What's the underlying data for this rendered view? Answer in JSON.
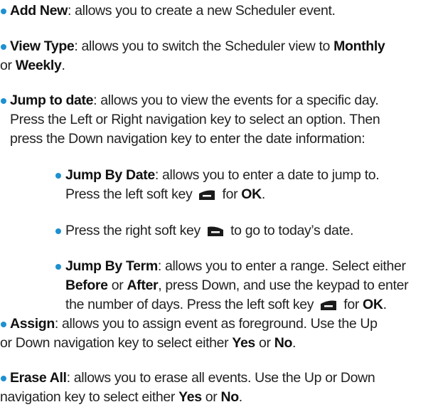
{
  "items": [
    {
      "term": "Add New",
      "desc": ": allows you to create a new Scheduler event."
    },
    {
      "term": "View Type",
      "desc_a": ": allows you to switch the Scheduler view to ",
      "opt1": "Monthly",
      "line2_pre": "or ",
      "opt2": "Weekly",
      "line2_post": "."
    },
    {
      "term": "Jump to date",
      "desc_a": ": allows you to view the events for a specific day.",
      "line2": "Press the Left or Right navigation key to select an option. Then",
      "line3": "press the Down navigation key to enter the date information:"
    },
    {
      "term": "Assign",
      "desc_a": ": allows you to assign event as foreground. Use the Up",
      "line2_pre": "or Down navigation key to select either ",
      "opt1": "Yes",
      "mid": " or ",
      "opt2": "No",
      "line2_post": "."
    },
    {
      "term": "Erase All",
      "desc_a": ": allows you to erase all events. Use the Up or Down",
      "line2_pre": "navigation key to select either ",
      "opt1": "Yes",
      "mid": " or ",
      "opt2": "No",
      "line2_post": "."
    }
  ],
  "subitems": [
    {
      "term": "Jump By Date",
      "desc_a": ": allows you to enter a date to jump to.",
      "line2_pre": "Press the left soft key ",
      "line2_icon": "left-soft-key-icon",
      "line2_mid": " for ",
      "line2_bold": "OK",
      "line2_post": "."
    },
    {
      "text_pre": "Press the right soft key ",
      "icon": "right-soft-key-icon",
      "text_post": " to go to today’s date."
    },
    {
      "term": "Jump By Term",
      "desc_a": ": allows you to enter a range. Select either",
      "l2_b1": "Before",
      "l2_t1": " or ",
      "l2_b2": "After",
      "l2_t2": ", press Down, and use the keypad to enter",
      "l3_pre": "the number of days. Press the left soft key ",
      "l3_icon": "left-soft-key-icon",
      "l3_mid": " for ",
      "l3_bold": "OK",
      "l3_post": "."
    }
  ],
  "colors": {
    "bullet": "#1e90d0",
    "text": "#222222",
    "icon": "#1a1a1a"
  }
}
